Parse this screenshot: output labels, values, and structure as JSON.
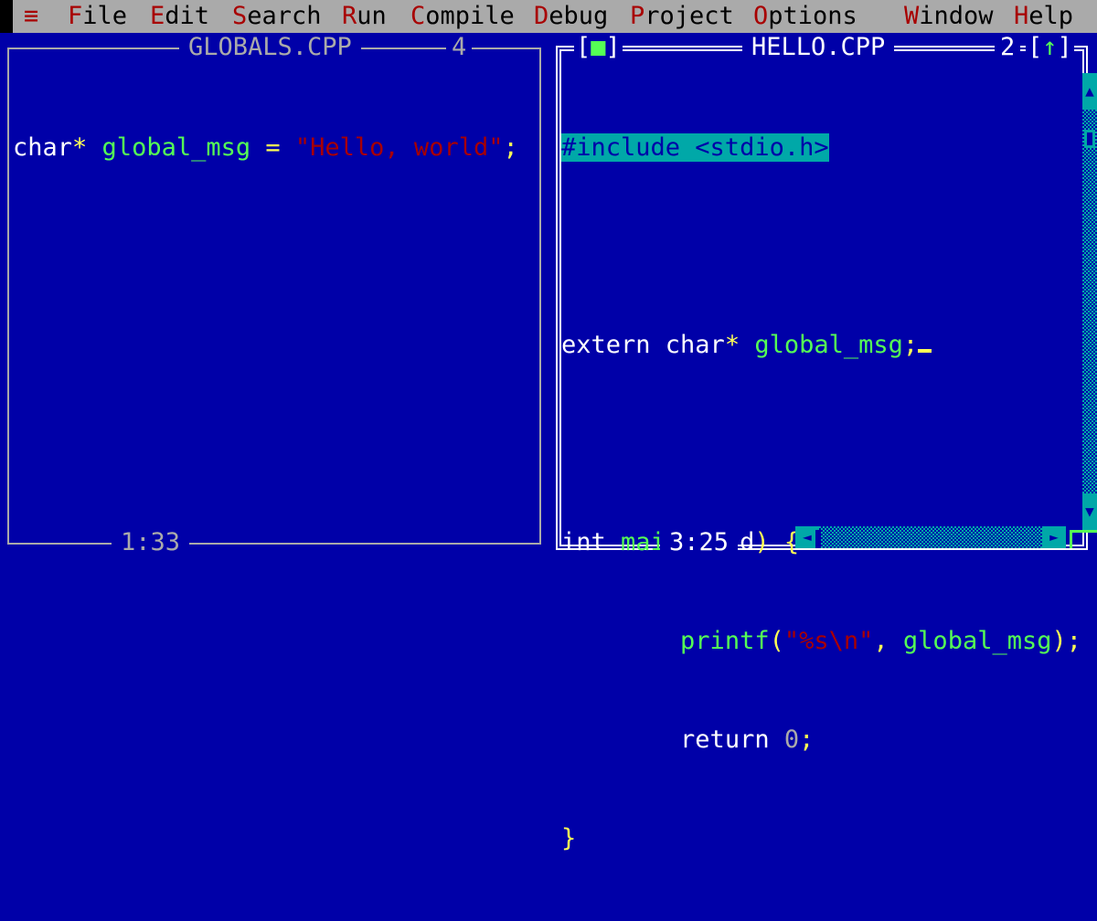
{
  "menubar": {
    "system_icon": "≡",
    "items": [
      {
        "hotkey": "F",
        "rest": "ile"
      },
      {
        "hotkey": "E",
        "rest": "dit"
      },
      {
        "hotkey": "S",
        "rest": "earch"
      },
      {
        "hotkey": "R",
        "rest": "un"
      },
      {
        "hotkey": "C",
        "rest": "ompile"
      },
      {
        "hotkey": "D",
        "rest": "ebug"
      },
      {
        "hotkey": "P",
        "rest": "roject"
      },
      {
        "hotkey": "O",
        "rest": "ptions"
      },
      {
        "hotkey": "W",
        "rest": "indow"
      },
      {
        "hotkey": "H",
        "rest": "elp"
      }
    ]
  },
  "windows": {
    "globals": {
      "title": "GLOBALS.CPP",
      "number": "4",
      "cursor_pos": "1:33",
      "code": {
        "l1": {
          "kw": "char",
          "star": "*",
          "ident": " global_msg",
          "eq": " = ",
          "str": "\"Hello, world\"",
          "semi": ";"
        }
      }
    },
    "hello": {
      "title": "HELLO.CPP",
      "number": "2",
      "close_button": "■",
      "zoom_button": "↑",
      "cursor_pos": "3:25",
      "code": {
        "l1": "#include <stdio.h>",
        "l3": {
          "kw": "extern char",
          "star": "*",
          "ident": " global_msg",
          "semi": ";"
        },
        "l5": {
          "kw": "int ",
          "fn": "main",
          "paren_open": "(",
          "void": "void",
          "paren_close": ")",
          "brace": " {"
        },
        "l6": {
          "indent": "        ",
          "fn": "printf",
          "paren_open": "(",
          "str": "\"%s\\n\"",
          "comma": ", ",
          "ident": "global_msg",
          "end": ");"
        },
        "l7": {
          "indent": "        ",
          "kw": "return ",
          "num": "0",
          "semi": ";"
        },
        "l8": "}"
      }
    }
  },
  "scrollbars": {
    "up_arrow": "▲",
    "down_arrow": "▼",
    "left_arrow": "◄",
    "right_arrow": "►"
  }
}
